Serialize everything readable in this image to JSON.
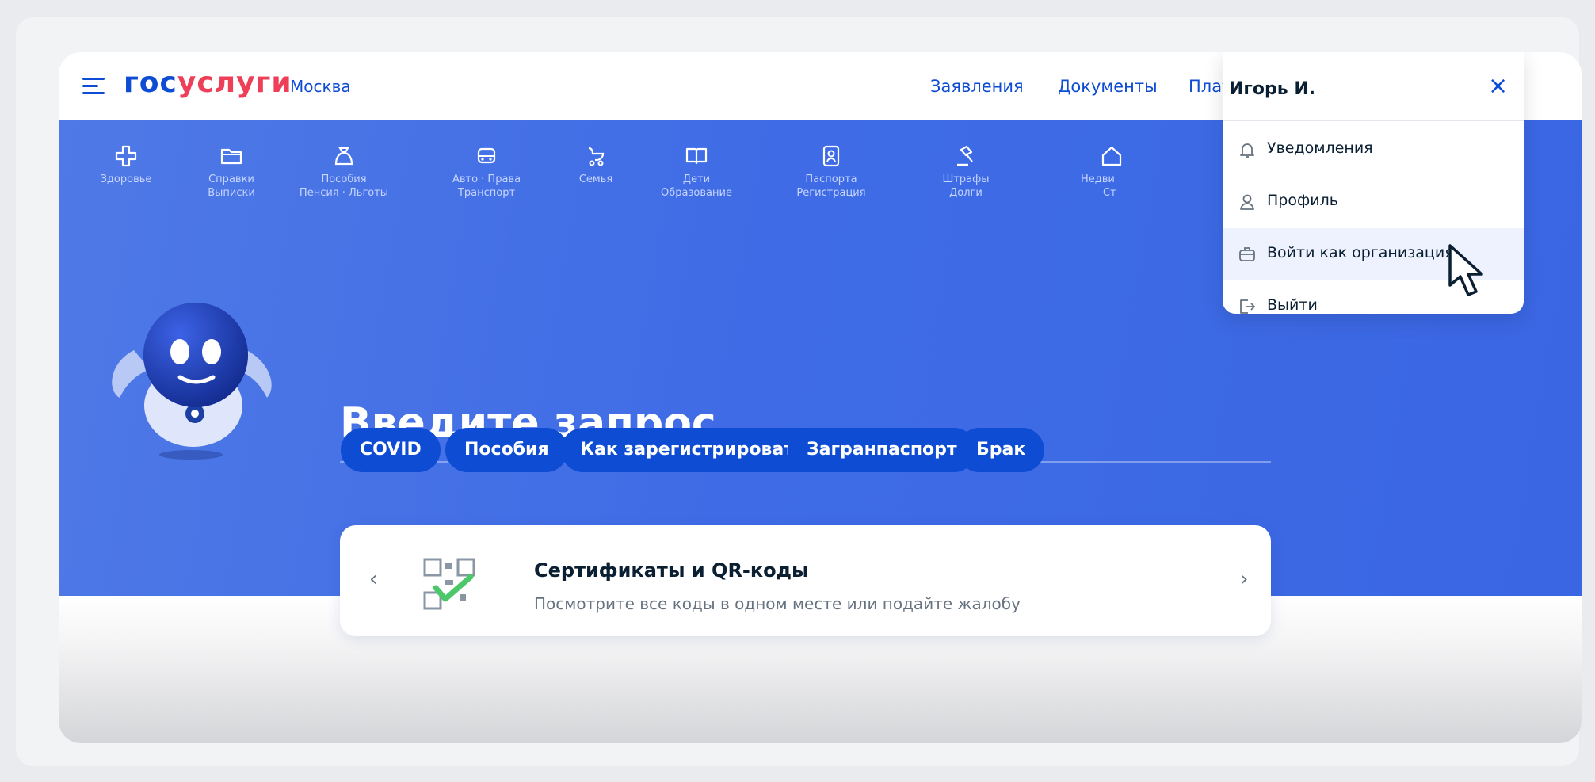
{
  "header": {
    "logo_part1": "гос",
    "logo_part2": "услуги",
    "city": "Москва",
    "nav": [
      "Заявления",
      "Документы",
      "Платежи"
    ]
  },
  "categories": [
    {
      "line1": "Здоровье",
      "line2": "",
      "icon": "health-icon"
    },
    {
      "line1": "Справки",
      "line2": "Выписки",
      "icon": "folder-icon"
    },
    {
      "line1": "Пособия",
      "line2": "Пенсия · Льготы",
      "icon": "wallet-icon"
    },
    {
      "line1": "Авто · Права",
      "line2": "Транспорт",
      "icon": "car-icon"
    },
    {
      "line1": "Семья",
      "line2": "",
      "icon": "stroller-icon"
    },
    {
      "line1": "Дети",
      "line2": "Образование",
      "icon": "book-icon"
    },
    {
      "line1": "Паспорта",
      "line2": "Регистрация",
      "icon": "passport-icon"
    },
    {
      "line1": "Штрафы",
      "line2": "Долги",
      "icon": "gavel-icon"
    },
    {
      "line1": "Недви",
      "line2": "Ст",
      "icon": "house-icon"
    }
  ],
  "search": {
    "title": "Введите запрос...",
    "chips": [
      "COVID",
      "Пособия",
      "Как зарегистрироваться",
      "Загранпаспорт",
      "Брак"
    ]
  },
  "card": {
    "title": "Сертификаты и QR-коды",
    "subtitle": "Посмотрите все коды в одном месте или подайте жалобу",
    "prev": "‹",
    "next": "›"
  },
  "user_menu": {
    "name": "Игорь И.",
    "close": "×",
    "items": [
      {
        "label": "Уведомления",
        "icon": "bell-icon"
      },
      {
        "label": "Профиль",
        "icon": "user-icon"
      },
      {
        "label": "Войти как организация",
        "icon": "briefcase-icon"
      },
      {
        "label": "Выйти",
        "icon": "logout-icon"
      }
    ]
  },
  "colors": {
    "brand_blue": "#0d4cd3",
    "brand_red": "#ee3f58",
    "banner_blue": "#3f6ce6"
  }
}
